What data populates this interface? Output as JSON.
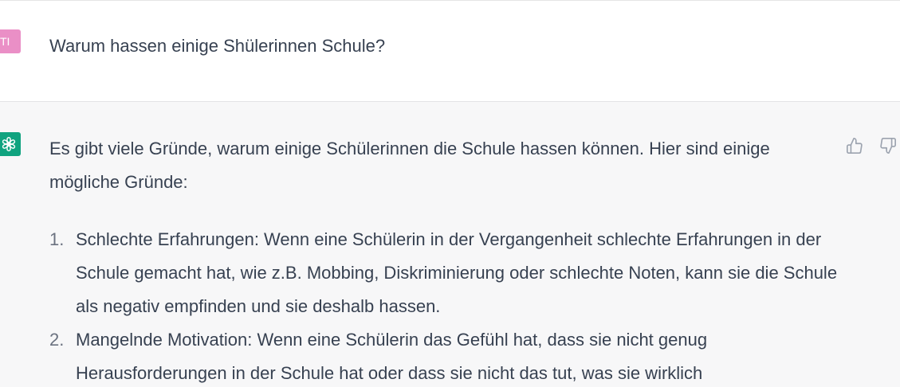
{
  "user_message": {
    "avatar_initials": "TI",
    "avatar_color": "#ea8fc6",
    "text": "Warum hassen einige Shülerinnen Schule?"
  },
  "assistant_message": {
    "avatar_icon": "openai-logo-icon",
    "avatar_color": "#10a37f",
    "intro": "Es gibt viele Gründe, warum einige Schülerinnen die Schule hassen können. Hier sind einige mögliche Gründe:",
    "items": [
      {
        "number": "1.",
        "text": "Schlechte Erfahrungen: Wenn eine Schülerin in der Vergangenheit schlechte Erfahrungen in der Schule gemacht hat, wie z.B. Mobbing, Diskriminierung oder schlechte Noten, kann sie die Schule als negativ empfinden und sie deshalb hassen."
      },
      {
        "number": "2.",
        "text": "Mangelnde Motivation: Wenn eine Schülerin das Gefühl hat, dass sie nicht genug Herausforderungen in der Schule hat oder dass sie nicht das tut, was sie wirklich"
      }
    ],
    "feedback_icons": [
      "thumbs-up-icon",
      "thumbs-down-icon"
    ]
  }
}
